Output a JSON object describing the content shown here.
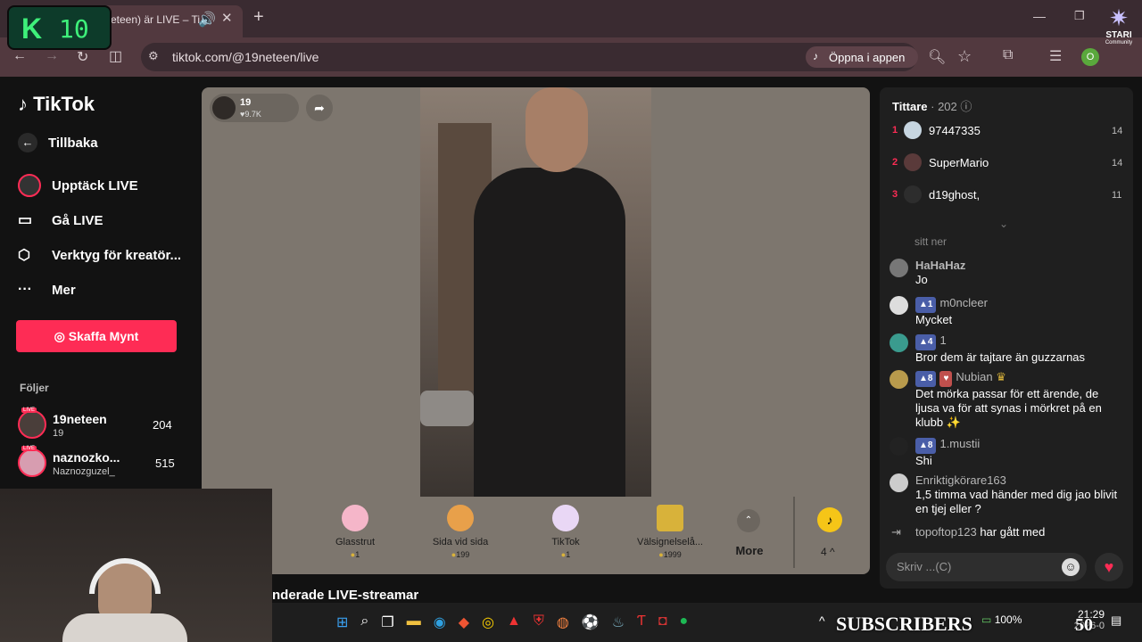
{
  "overlay": {
    "logo_letter": "K",
    "logo_number": "10",
    "subscribers": "SUBSCRIBERS",
    "sub_count": "50",
    "stari": "STARI",
    "community": "Community"
  },
  "browser": {
    "tab_title": "eteen) är LIVE – Ti",
    "url": "tiktok.com/@19neteen/live",
    "open_app": "Öppna i appen",
    "profile_initial": "O"
  },
  "tiktok": {
    "brand": "TikTok",
    "nav": [
      {
        "label": "Tillbaka",
        "icon": "arrow-left-icon"
      },
      {
        "label": "Upptäck LIVE",
        "icon": "live-avatar-icon"
      },
      {
        "label": "Gå LIVE",
        "icon": "camera-icon"
      },
      {
        "label": "Verktyg för kreatör...",
        "icon": "creator-tools-icon"
      },
      {
        "label": "Mer",
        "icon": "more-icon"
      }
    ],
    "cta": "Skaffa Mynt",
    "following_title": "Följer",
    "following": [
      {
        "name": "19neteen",
        "sub": "19",
        "count": "204",
        "live": "LIVE"
      },
      {
        "name": "naznozko...",
        "sub": "Naznozguzel_",
        "count": "515",
        "live": "LIVE"
      }
    ],
    "recommended_partial": "nderade LIVE-streamar"
  },
  "stream": {
    "host_name": "19",
    "host_likes": "9.7K",
    "gifts": [
      {
        "name": "Glasstrut",
        "price": "1",
        "color": "#f5b6c9"
      },
      {
        "name": "Sida vid sida",
        "price": "199",
        "color": "#e8a04a"
      },
      {
        "name": "TikTok",
        "price": "1",
        "color": "#e9d7f5"
      },
      {
        "name": "Välsignelselå...",
        "price": "1999",
        "color": "#d8b23a"
      }
    ],
    "more_label": "More",
    "coin_count": "4"
  },
  "viewers": {
    "title": "Tittare",
    "count": "· 202",
    "top": [
      {
        "rank": "1",
        "name": "97447335",
        "score": "14"
      },
      {
        "rank": "2",
        "name": "SuperMario",
        "score": "14"
      },
      {
        "rank": "3",
        "name": "d19ghost,",
        "score": "11"
      }
    ]
  },
  "chat": {
    "partial_top": "sitt ner",
    "messages": [
      {
        "user": "HaHaHaz",
        "badge": "",
        "text": "Jo",
        "avatar": "#777"
      },
      {
        "user": "m0ncleer",
        "badge": "1",
        "text": "Mycket",
        "avatar": "#ddd"
      },
      {
        "user": "1",
        "badge": "4",
        "text": "Bror dem är tajtare än guzzarnas",
        "avatar": "#3a9b8e"
      },
      {
        "user": "Nubian",
        "badge": "8",
        "text": "Det mörka passar för ett ärende, de ljusa va för att synas i mörkret på en klubb ✨",
        "avatar": "#b89a4c"
      },
      {
        "user": "1.mustii",
        "badge": "8",
        "text": "Shi",
        "avatar": "#222"
      },
      {
        "user": "Enriktigkörare163",
        "badge": "",
        "text": "1,5 timma vad händer med dig jao blivit en tjej eller ?",
        "avatar": "#ccc"
      }
    ],
    "join_user": "topoftop123",
    "join_text": "har gått med",
    "input_placeholder": "Skriv ...(C)"
  },
  "taskbar": {
    "battery": "100%",
    "time": "21:29",
    "date": "2026-0"
  }
}
